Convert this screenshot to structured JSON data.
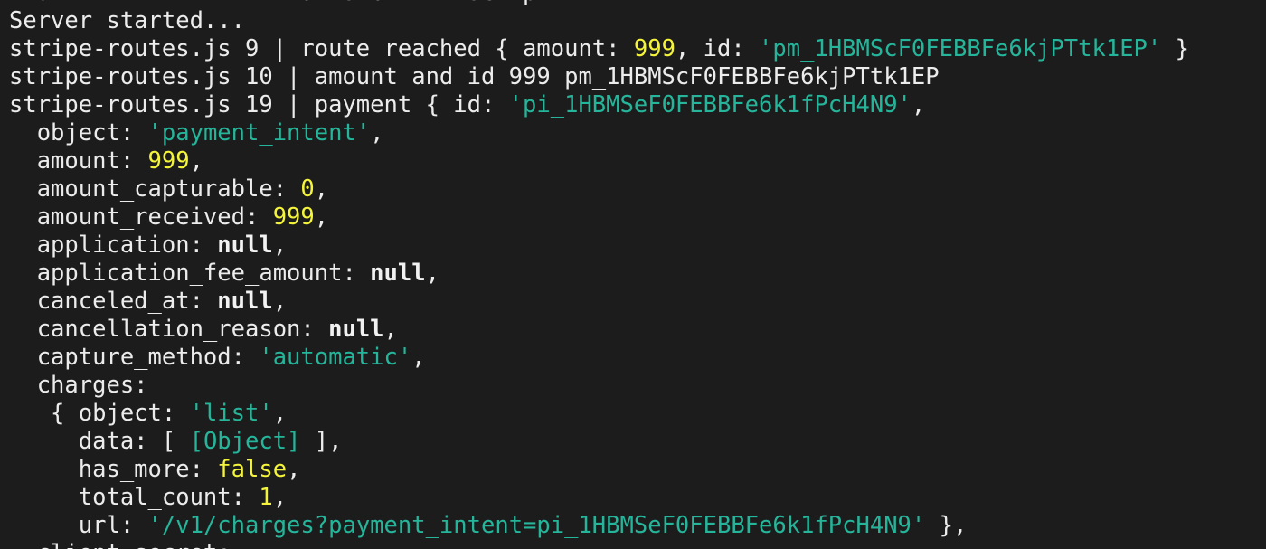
{
  "terminal": {
    "lines": [
      [
        {
          "t": "plain",
          "v": "  at mi              d  s b      sc  pt"
        }
      ],
      [
        {
          "t": "plain",
          "v": "Server started..."
        }
      ],
      [
        {
          "t": "plain",
          "v": "stripe-routes.js 9 | route reached { amount: "
        },
        {
          "t": "num",
          "v": "999"
        },
        {
          "t": "plain",
          "v": ", id: "
        },
        {
          "t": "str",
          "v": "'pm_1HBMScF0FEBBFe6kjPTtk1EP'"
        },
        {
          "t": "plain",
          "v": " }"
        }
      ],
      [
        {
          "t": "plain",
          "v": "stripe-routes.js 10 | amount and id 999 pm_1HBMScF0FEBBFe6kjPTtk1EP"
        }
      ],
      [
        {
          "t": "plain",
          "v": "stripe-routes.js 19 | payment { id: "
        },
        {
          "t": "str",
          "v": "'pi_1HBMSeF0FEBBFe6k1fPcH4N9'"
        },
        {
          "t": "plain",
          "v": ","
        }
      ],
      [
        {
          "t": "plain",
          "v": "  object: "
        },
        {
          "t": "str",
          "v": "'payment_intent'"
        },
        {
          "t": "plain",
          "v": ","
        }
      ],
      [
        {
          "t": "plain",
          "v": "  amount: "
        },
        {
          "t": "num",
          "v": "999"
        },
        {
          "t": "plain",
          "v": ","
        }
      ],
      [
        {
          "t": "plain",
          "v": "  amount_capturable: "
        },
        {
          "t": "num",
          "v": "0"
        },
        {
          "t": "plain",
          "v": ","
        }
      ],
      [
        {
          "t": "plain",
          "v": "  amount_received: "
        },
        {
          "t": "num",
          "v": "999"
        },
        {
          "t": "plain",
          "v": ","
        }
      ],
      [
        {
          "t": "plain",
          "v": "  application: "
        },
        {
          "t": "kw",
          "v": "null"
        },
        {
          "t": "plain",
          "v": ","
        }
      ],
      [
        {
          "t": "plain",
          "v": "  application_fee_amount: "
        },
        {
          "t": "kw",
          "v": "null"
        },
        {
          "t": "plain",
          "v": ","
        }
      ],
      [
        {
          "t": "plain",
          "v": "  canceled_at: "
        },
        {
          "t": "kw",
          "v": "null"
        },
        {
          "t": "plain",
          "v": ","
        }
      ],
      [
        {
          "t": "plain",
          "v": "  cancellation_reason: "
        },
        {
          "t": "kw",
          "v": "null"
        },
        {
          "t": "plain",
          "v": ","
        }
      ],
      [
        {
          "t": "plain",
          "v": "  capture_method: "
        },
        {
          "t": "str",
          "v": "'automatic'"
        },
        {
          "t": "plain",
          "v": ","
        }
      ],
      [
        {
          "t": "plain",
          "v": "  charges:"
        }
      ],
      [
        {
          "t": "plain",
          "v": "   { object: "
        },
        {
          "t": "str",
          "v": "'list'"
        },
        {
          "t": "plain",
          "v": ","
        }
      ],
      [
        {
          "t": "plain",
          "v": "     data: [ "
        },
        {
          "t": "str",
          "v": "[Object]"
        },
        {
          "t": "plain",
          "v": " ],"
        }
      ],
      [
        {
          "t": "plain",
          "v": "     has_more: "
        },
        {
          "t": "bool",
          "v": "false"
        },
        {
          "t": "plain",
          "v": ","
        }
      ],
      [
        {
          "t": "plain",
          "v": "     total_count: "
        },
        {
          "t": "num",
          "v": "1"
        },
        {
          "t": "plain",
          "v": ","
        }
      ],
      [
        {
          "t": "plain",
          "v": "     url: "
        },
        {
          "t": "str",
          "v": "'/v1/charges?payment_intent=pi_1HBMSeF0FEBBFe6k1fPcH4N9'"
        },
        {
          "t": "plain",
          "v": " },"
        }
      ],
      [
        {
          "t": "plain",
          "v": "  client_secret:"
        }
      ]
    ]
  },
  "colors": {
    "background": "#1c1c1c",
    "text": "#ececec",
    "number": "#f4f43a",
    "string": "#25b59a"
  }
}
